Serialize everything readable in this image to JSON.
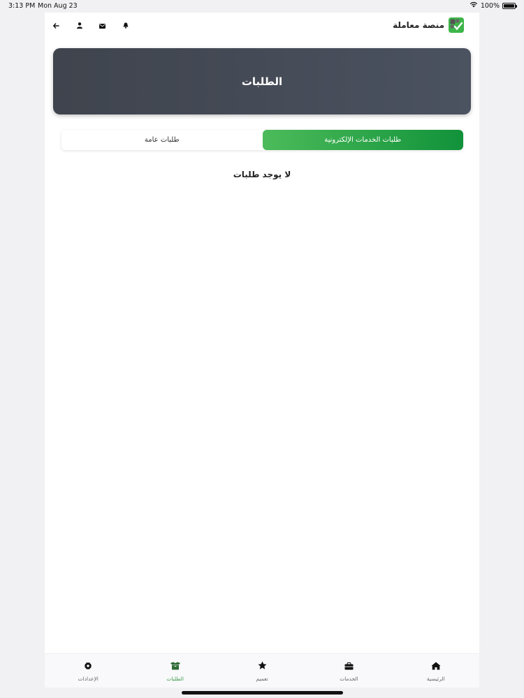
{
  "status_bar": {
    "time": "3:13 PM",
    "date": "Mon Aug 23",
    "battery": "100%",
    "battery_level": 1.0
  },
  "header": {
    "brand": "منصة معاملة",
    "icons": [
      "back-arrow-icon",
      "user-icon",
      "envelope-icon",
      "bell-icon"
    ]
  },
  "hero": {
    "title": "الطلبات"
  },
  "tabs": {
    "electronic_services": "طلبات الخدمات الإلكترونية",
    "general": "طلبات عامة",
    "active": "electronic_services"
  },
  "empty_state": "لا يوجد طلبات",
  "bottom_nav": {
    "settings": "الإعدادات",
    "requests": "الطلبات",
    "circular": "تعميم",
    "services": "الخدمات",
    "home": "الرئيسية",
    "active": "requests"
  },
  "colors": {
    "accent": "#3db54a",
    "accent_dark": "#11923a",
    "hero_bg": "#434954"
  }
}
